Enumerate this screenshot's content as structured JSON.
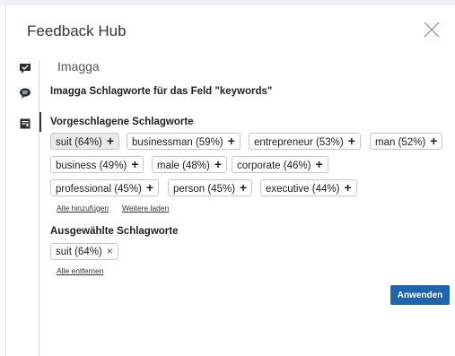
{
  "header": {
    "title": "Feedback Hub"
  },
  "rail": {
    "icons": [
      "feedback-icon",
      "comment-icon",
      "document-icon"
    ]
  },
  "plugin": {
    "title": "Imagga",
    "field_title": "Imagga Schlagworte für das Feld \"keywords\""
  },
  "suggested": {
    "title": "Vorgeschlagene Schlagworte",
    "tags": [
      "suit (64%)",
      "businessman (59%)",
      "entrepreneur (53%)",
      "man (52%)",
      "business (49%)",
      "male (48%)",
      "corporate (46%)",
      "professional (45%)",
      "person (45%)",
      "executive (44%)"
    ],
    "add_icon": "+",
    "add_all_label": "Alle hinzufügen",
    "load_more_label": "Weitere laden"
  },
  "selected": {
    "title": "Ausgewählte Schlagworte",
    "tags": [
      "suit (64%)"
    ],
    "remove_icon": "×",
    "remove_all_label": "Alle entfernen"
  },
  "actions": {
    "apply_label": "Anwenden"
  },
  "colors": {
    "primary": "#1f65ad",
    "selected_bg": "#e9e9e9",
    "border": "#c6c6c6"
  }
}
